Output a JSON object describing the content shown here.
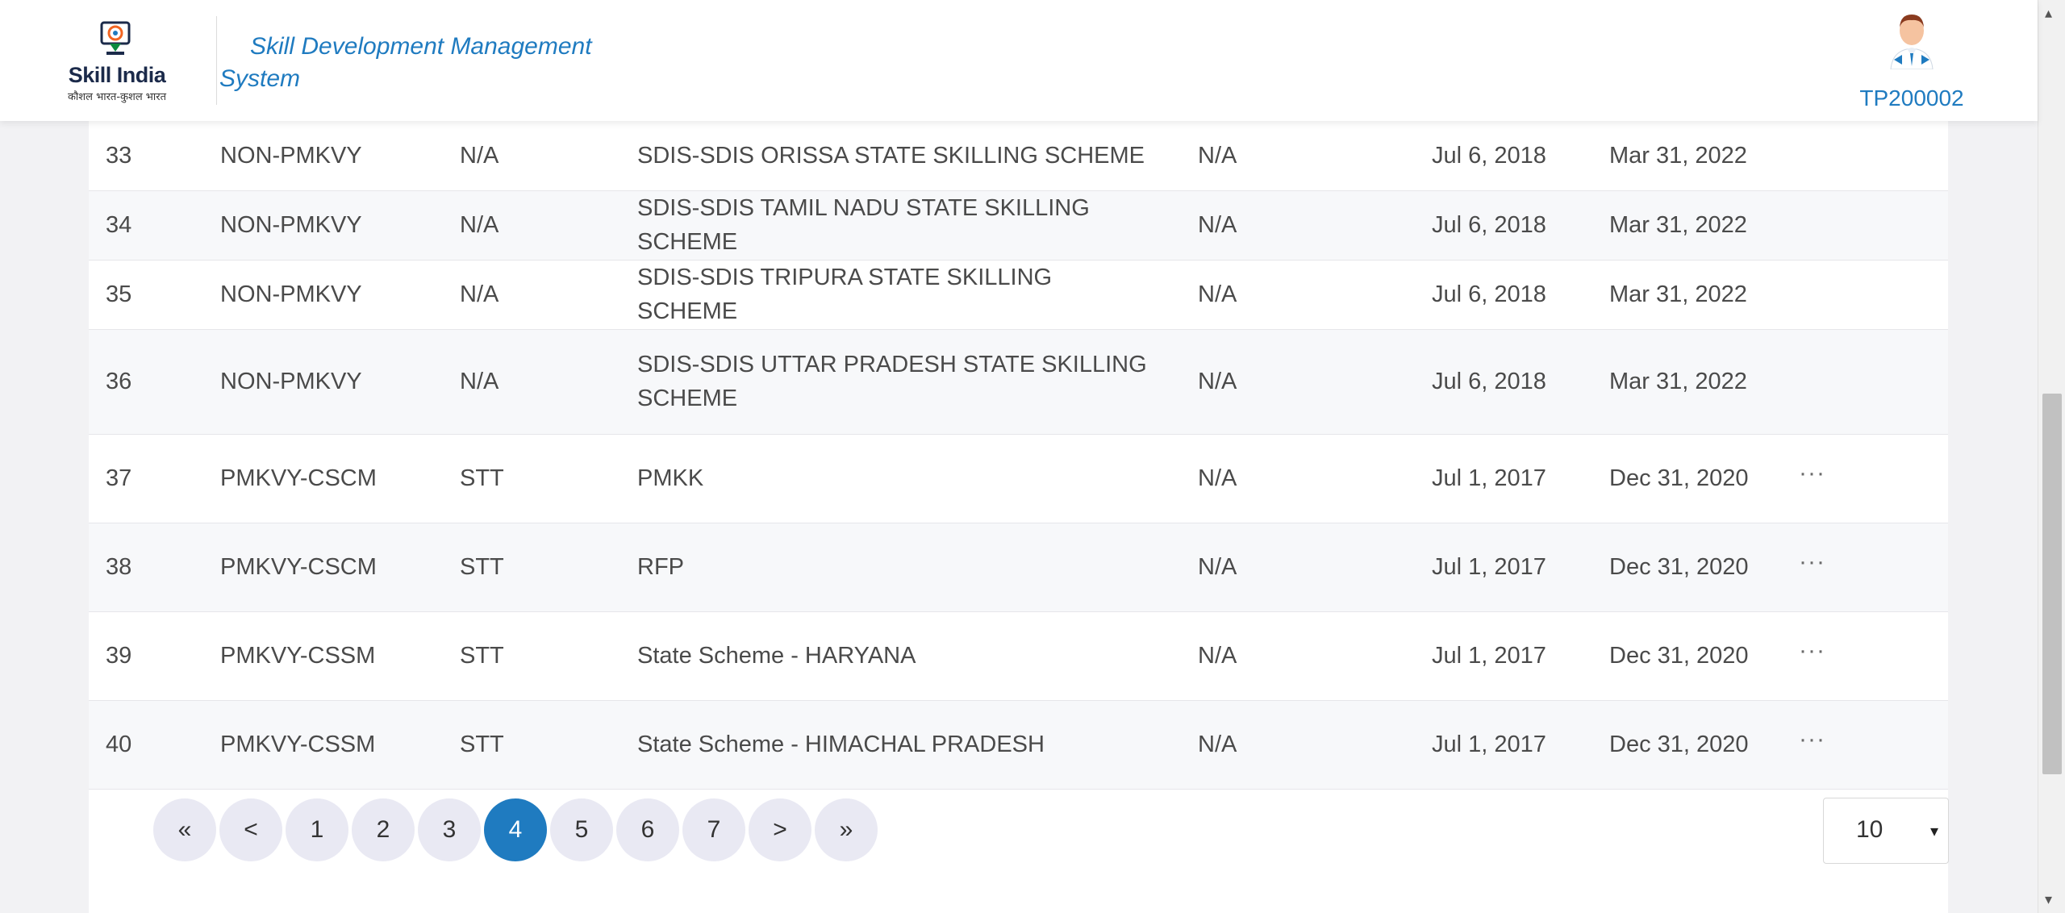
{
  "header": {
    "logo_text": "Skill India",
    "logo_subtext": "कौशल भारत-कुशल भारत",
    "app_title": "Skill Development Management System",
    "user_id": "TP200002"
  },
  "rows": [
    {
      "no": "33",
      "type": "NON-PMKVY",
      "category": "N/A",
      "name": "SDIS-SDIS ORISSA STATE SKILLING SCHEME",
      "na": "N/A",
      "start": "Jul 6, 2018",
      "end": "Mar 31, 2022",
      "actions": ""
    },
    {
      "no": "34",
      "type": "NON-PMKVY",
      "category": "N/A",
      "name": "SDIS-SDIS TAMIL NADU STATE SKILLING SCHEME",
      "na": "N/A",
      "start": "Jul 6, 2018",
      "end": "Mar 31, 2022",
      "actions": ""
    },
    {
      "no": "35",
      "type": "NON-PMKVY",
      "category": "N/A",
      "name": "SDIS-SDIS TRIPURA STATE SKILLING SCHEME",
      "na": "N/A",
      "start": "Jul 6, 2018",
      "end": "Mar 31, 2022",
      "actions": ""
    },
    {
      "no": "36",
      "type": "NON-PMKVY",
      "category": "N/A",
      "name": "SDIS-SDIS UTTAR PRADESH STATE SKILLING SCHEME",
      "na": "N/A",
      "start": "Jul 6, 2018",
      "end": "Mar 31, 2022",
      "actions": ""
    },
    {
      "no": "37",
      "type": "PMKVY-CSCM",
      "category": "STT",
      "name": "PMKK",
      "na": "N/A",
      "start": "Jul 1, 2017",
      "end": "Dec 31, 2020",
      "actions": "···"
    },
    {
      "no": "38",
      "type": "PMKVY-CSCM",
      "category": "STT",
      "name": "RFP",
      "na": "N/A",
      "start": "Jul 1, 2017",
      "end": "Dec 31, 2020",
      "actions": "···"
    },
    {
      "no": "39",
      "type": "PMKVY-CSSM",
      "category": "STT",
      "name": "State Scheme - HARYANA",
      "na": "N/A",
      "start": "Jul 1, 2017",
      "end": "Dec 31, 2020",
      "actions": "···"
    },
    {
      "no": "40",
      "type": "PMKVY-CSSM",
      "category": "STT",
      "name": "State Scheme - HIMACHAL PRADESH",
      "na": "N/A",
      "start": "Jul 1, 2017",
      "end": "Dec 31, 2020",
      "actions": "···"
    }
  ],
  "pagination": {
    "first": "«",
    "prev": "<",
    "pages": [
      "1",
      "2",
      "3",
      "4",
      "5",
      "6",
      "7"
    ],
    "current": "4",
    "next": ">",
    "last": "»"
  },
  "page_size": {
    "value": "10",
    "caret": "▾"
  },
  "scrollbar": {
    "up": "▴",
    "down": "▾"
  },
  "colors": {
    "accent": "#1f7bc0",
    "pager_bg": "#e9e9f3",
    "row_alt": "#f7f8fa"
  }
}
